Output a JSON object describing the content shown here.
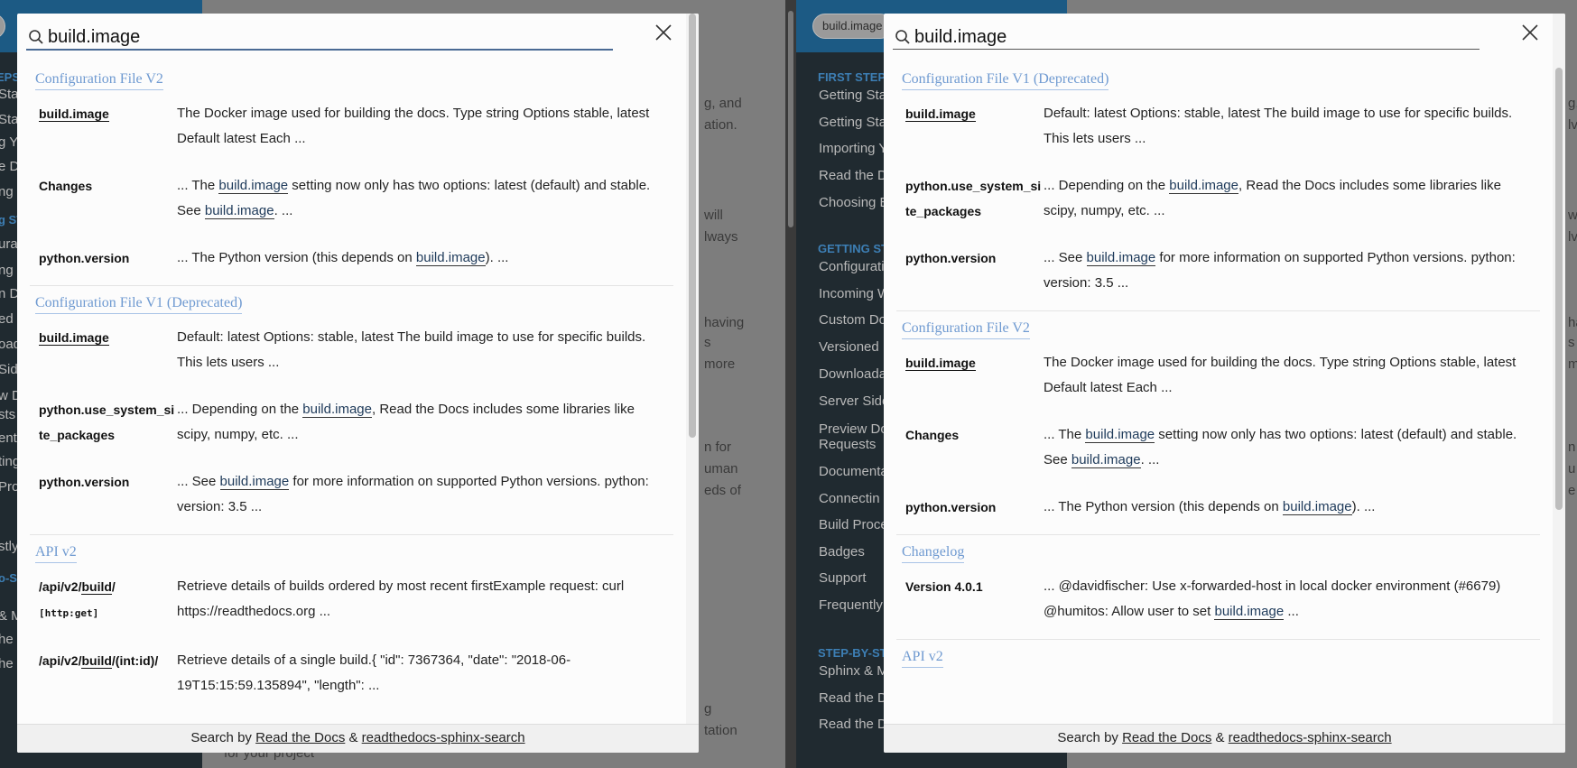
{
  "background": {
    "left_chip": "ge",
    "right_chip": "build.image",
    "left_side_items": [
      "Sta",
      "Sta",
      "g Y",
      "e Do",
      "ng B",
      "g ST",
      "urati",
      "ng W",
      "n Do",
      "ed D",
      "oad",
      "Side",
      "w Do",
      "sts",
      "enta",
      "ting",
      "Proce",
      "stly",
      "o-ST",
      "& M",
      "he Do",
      "he Do"
    ],
    "right_side_caption_1": "FIRST STEPS",
    "right_side_items_1": [
      "Getting Sta",
      "Getting Sta",
      "Importing Y",
      "Read the D",
      "Choosing B"
    ],
    "right_side_caption_2": "GETTING ST",
    "right_side_items_2": [
      "Configuratio",
      "Incoming W",
      "Custom Do",
      "Versioned D",
      "Downloada",
      "Server Side",
      "Preview Do",
      "Requests",
      "Documenta",
      "Connectin",
      "Build Proce",
      "Badges",
      "Support",
      "Frequently"
    ],
    "right_side_caption_3": "STEP-BY-ST",
    "right_side_items_3": [
      "Sphinx & M",
      "Read the D",
      "Read the D"
    ],
    "left_content_snippets": [
      "g, and",
      "ation.",
      "will",
      "lways",
      "having",
      "s",
      "more",
      "n for",
      "uman",
      "eds of",
      "g",
      "tation",
      "for your project"
    ],
    "right_content_snippets": [
      "g,",
      "lv",
      "w",
      "lv",
      "ha",
      "s",
      "m",
      "n",
      "u",
      "e"
    ]
  },
  "left_panel": {
    "query": "build.image",
    "sections": [
      {
        "title": "Configuration File V2",
        "hits": [
          {
            "key": "build.image",
            "key_underlined": true,
            "text": "The Docker image used for building the docs. Type string Options stable, latest Default latest Each ..."
          },
          {
            "key": "Changes",
            "key_underlined": false,
            "text_before": "... The ",
            "hl1": "build.image",
            "text_mid": " setting now only has two options: latest (default) and stable. See ",
            "hl2": "build.image",
            "text_after": ". ..."
          },
          {
            "key": "python.version",
            "key_underlined": false,
            "text_before": "... The Python version (this depends on ",
            "hl1": "build.image",
            "text_after": "). ..."
          }
        ]
      },
      {
        "title": "Configuration File V1 (Deprecated)",
        "hits": [
          {
            "key": "build.image",
            "key_underlined": true,
            "text": "Default: latest Options: stable, latest The build image to use for specific builds. This lets users ..."
          },
          {
            "key": "python.use_system_site_packages",
            "key_underlined": false,
            "text_before": "... Depending on the ",
            "hl1": "build.image",
            "text_after": ", Read the Docs includes some libraries like scipy, numpy, etc. ..."
          },
          {
            "key": "python.version",
            "key_underlined": false,
            "text_before": "... See ",
            "hl1": "build.image",
            "text_after": " for more information on supported Python versions. python: version: 3.5 ..."
          }
        ]
      },
      {
        "title": "API v2",
        "hits": [
          {
            "key_a": "/api/v2/",
            "key_b": "build",
            "key_c": "/",
            "key_tag": "[http:get]",
            "text": "Retrieve details of builds ordered by most recent firstExample request: curl https://readthedocs.org ..."
          },
          {
            "key_a": "/api/v2/",
            "key_b": "build",
            "key_c": "/(int:id)/",
            "text": "Retrieve details of a single build.{ \"id\": 7367364, \"date\": \"2018-06-19T15:15:59.135894\", \"length\": ..."
          }
        ]
      }
    ],
    "footer": {
      "prefix": "Search by ",
      "link1": "Read the Docs",
      "amp": " & ",
      "link2": "readthedocs-sphinx-search"
    }
  },
  "right_panel": {
    "query": "build.image",
    "sections": [
      {
        "title": "Configuration File V1 (Deprecated)",
        "hits": [
          {
            "key": "build.image",
            "text": "Default: latest Options: stable, latest The build image to use for specific builds. This lets users ..."
          },
          {
            "key": "python.use_system_site_packages",
            "text_before": "... Depending on the ",
            "hl1": "build.image",
            "text_after": ", Read the Docs includes some libraries like scipy, numpy, etc. ..."
          },
          {
            "key": "python.version",
            "text_before": "... See ",
            "hl1": "build.image",
            "text_after": " for more information on supported Python versions. python: version: 3.5 ..."
          }
        ]
      },
      {
        "title": "Configuration File V2",
        "hits": [
          {
            "key": "build.image",
            "text": "The Docker image used for building the docs. Type string Options stable, latest Default latest Each ..."
          },
          {
            "key": "Changes",
            "text_before": "... The ",
            "hl1": "build.image",
            "text_mid": " setting now only has two options: latest (default) and stable. See ",
            "hl2": "build.image",
            "text_after": ". ..."
          },
          {
            "key": "python.version",
            "text_before": "... The Python version (this depends on ",
            "hl1": "build.image",
            "text_after": "). ..."
          }
        ]
      },
      {
        "title": "Changelog",
        "hits": [
          {
            "key": "Version 4.0.1",
            "text_before": "... @davidfischer: Use x-forwarded-host in local docker environment (#6679) @humitos: Allow user to set ",
            "hl1": "build.image",
            "text_after": " ..."
          }
        ]
      },
      {
        "title": "API v2",
        "hits": []
      }
    ],
    "footer": {
      "prefix": "Search by ",
      "link1": "Read the Docs",
      "amp": " & ",
      "link2": "readthedocs-sphinx-search"
    }
  },
  "colors": {
    "section_title": "#6f9ad1",
    "modal_bg": "#fcfcfc",
    "overlay": "#7a7a7a",
    "sidebar": "#202a30"
  },
  "icons": {
    "search": "search-icon",
    "close": "close-icon"
  }
}
